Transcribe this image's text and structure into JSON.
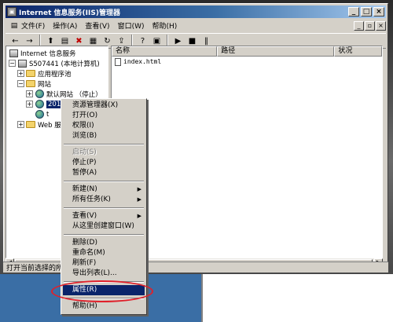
{
  "window": {
    "title": "Internet 信息服务(IIS)管理器",
    "app_icon_glyph": "▣",
    "controls": [
      "_",
      "□",
      "×"
    ]
  },
  "menubar": {
    "items": [
      "文件(F)",
      "操作(A)",
      "查看(V)",
      "窗口(W)",
      "帮助(H)"
    ],
    "mdi_controls": [
      "_",
      "▫",
      "×"
    ]
  },
  "toolbar": {
    "buttons": [
      "back-icon",
      "forward-icon",
      "up-icon",
      "show-hide-tree-icon",
      "delete-icon",
      "properties-icon",
      "refresh-icon",
      "export-icon",
      "help-icon",
      "console-icon",
      "start-icon",
      "stop-icon",
      "pause-icon"
    ],
    "glyphs": [
      "←",
      "→",
      "⬆",
      "▤",
      "✖",
      "▦",
      "↻",
      "⇪",
      "?",
      "▣",
      "▶",
      "■",
      "‖"
    ]
  },
  "tree": {
    "root": "Internet 信息服务",
    "computer": "S507441 (本地计算机)",
    "app_pools": "应用程序池",
    "websites": "网站",
    "default_site": "默认网站 （停止）",
    "selected_site": "201",
    "other_site": "t",
    "web_ext": "Web 服"
  },
  "list": {
    "columns": [
      "名称",
      "路径",
      "状况"
    ],
    "rows": [
      {
        "name": "index.html"
      }
    ]
  },
  "statusbar": {
    "text": "打开当前选择的所"
  },
  "context_menu": {
    "items": [
      {
        "label": "资源管理器(X)",
        "state": "normal"
      },
      {
        "label": "打开(O)",
        "state": "normal"
      },
      {
        "label": "权限(I)",
        "state": "normal"
      },
      {
        "label": "浏览(B)",
        "state": "normal"
      },
      {
        "sep": true
      },
      {
        "label": "启动(S)",
        "state": "disabled"
      },
      {
        "label": "停止(P)",
        "state": "normal"
      },
      {
        "label": "暂停(A)",
        "state": "normal"
      },
      {
        "sep": true
      },
      {
        "label": "新建(N)",
        "state": "normal",
        "submenu": true
      },
      {
        "label": "所有任务(K)",
        "state": "normal",
        "submenu": true
      },
      {
        "sep": true
      },
      {
        "label": "查看(V)",
        "state": "normal",
        "submenu": true
      },
      {
        "label": "从这里创建窗口(W)",
        "state": "normal"
      },
      {
        "sep": true
      },
      {
        "label": "删除(D)",
        "state": "normal"
      },
      {
        "label": "重命名(M)",
        "state": "normal"
      },
      {
        "label": "刷新(F)",
        "state": "normal"
      },
      {
        "label": "导出列表(L)...",
        "state": "normal"
      },
      {
        "sep": true
      },
      {
        "label": "属性(R)",
        "state": "highlighted"
      },
      {
        "sep": true
      },
      {
        "label": "帮助(H)",
        "state": "normal"
      }
    ]
  },
  "colors": {
    "title_start": "#0a246a",
    "title_end": "#a6caf0",
    "highlight": "#0a246a",
    "annotation": "#e0202a",
    "face": "#d4d0c8"
  }
}
